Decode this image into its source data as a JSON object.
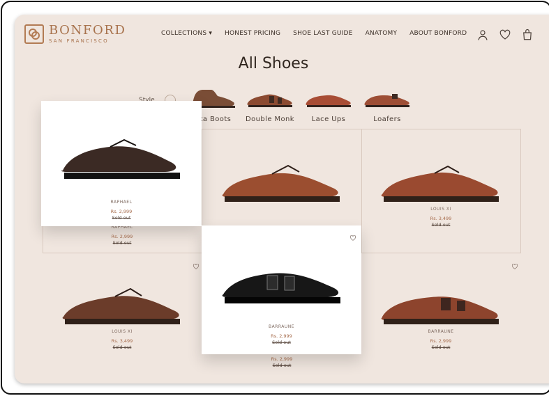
{
  "brand": {
    "name": "BONFORD",
    "subtitle": "SAN FRANCISCO"
  },
  "nav": {
    "items": [
      "COLLECTIONS",
      "HONEST PRICING",
      "SHOE LAST GUIDE",
      "ANATOMY",
      "ABOUT BONFORD"
    ],
    "dropdown": "▾"
  },
  "header_icons": [
    "user-icon",
    "heart-icon",
    "shopping-bag-icon"
  ],
  "page_title": "All Shoes",
  "style_label": "Style",
  "categories": [
    {
      "label": "Chukka Boots",
      "visible_label": "kka Boots"
    },
    {
      "label": "Double Monk"
    },
    {
      "label": "Lace Ups"
    },
    {
      "label": "Loafers"
    }
  ],
  "products": [
    {
      "name": "RAPHAEL",
      "price": "Rs. 2,999",
      "status": "Sold out"
    },
    {
      "name": "RAPHAEL",
      "price": "Rs. 2,999",
      "status": "Sold out"
    },
    {
      "name": "",
      "price": "",
      "status": ""
    },
    {
      "name": "LOUIS XI",
      "price": "Rs. 3,499",
      "status": "Sold out"
    },
    {
      "name": "LOUIS XI",
      "price": "Rs. 3,499",
      "status": "Sold out"
    },
    {
      "name": "BARRAUNE",
      "price": "Rs. 2,999",
      "status": "Sold out"
    },
    {
      "name": "BARRAUNE",
      "price": "Rs. 2,999",
      "status": "Sold out"
    },
    {
      "name": "BARRAUNE",
      "price": "Rs. 2,999",
      "status": "Sold out"
    }
  ],
  "colors": {
    "background": "#f0e6df",
    "accent": "#a8734d",
    "text": "#312720"
  }
}
